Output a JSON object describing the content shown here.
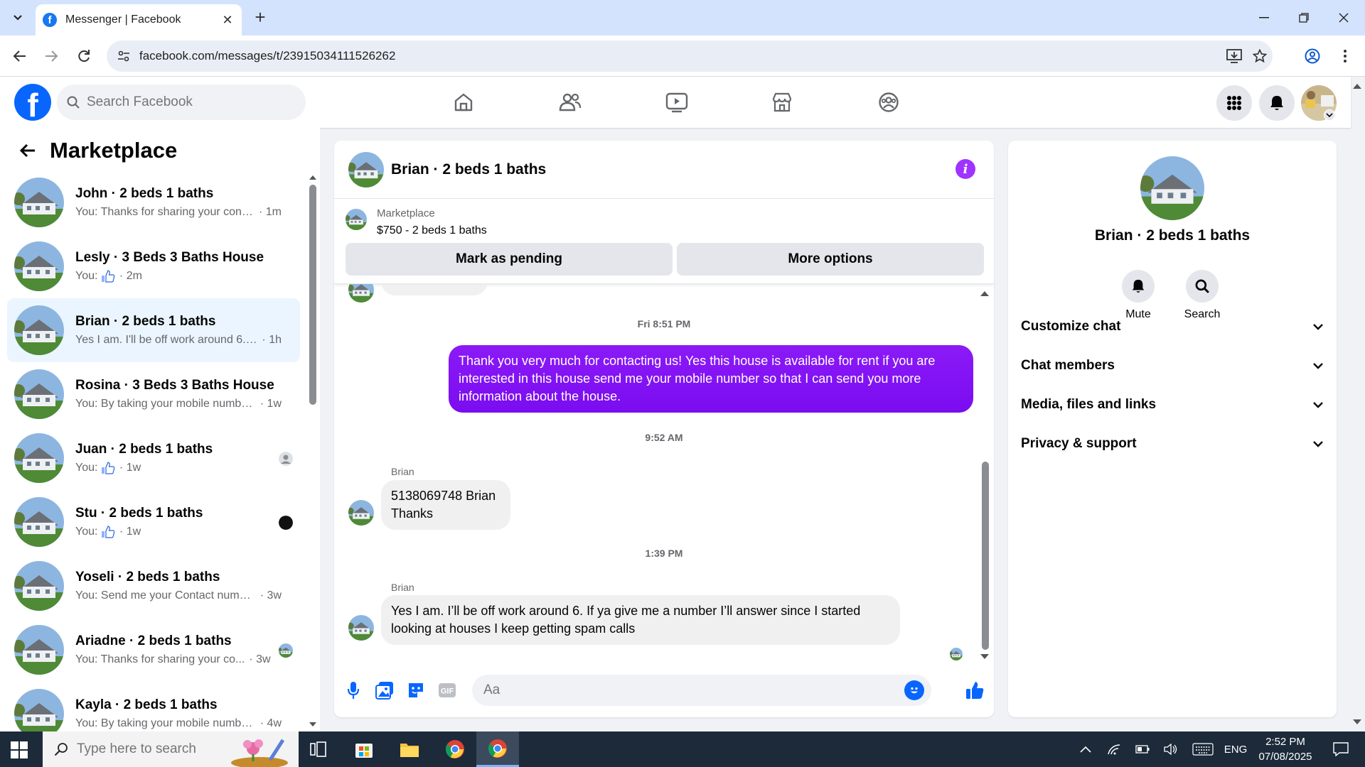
{
  "browser": {
    "tab_title": "Messenger | Facebook",
    "url": "facebook.com/messages/t/23915034111526262"
  },
  "facebook": {
    "logo_letter": "f",
    "search_placeholder": "Search Facebook"
  },
  "left_panel": {
    "title": "Marketplace",
    "chats": [
      {
        "name": "John · 2 beds 1 baths",
        "preview": "You: Thanks for sharing your conta...",
        "time": "1m",
        "thumb": false,
        "active": false
      },
      {
        "name": "Lesly · 3 Beds 3 Baths House",
        "preview": "You:",
        "time": "2m",
        "thumb": true,
        "active": false
      },
      {
        "name": "Brian · 2 beds 1 baths",
        "preview": "Yes I am. I'll be off work around 6. If...",
        "time": "1h",
        "thumb": false,
        "active": true
      },
      {
        "name": "Rosina · 3 Beds 3 Baths House",
        "preview": "You: By taking your mobile number...",
        "time": "1w",
        "thumb": false,
        "active": false
      },
      {
        "name": "Juan · 2 beds 1 baths",
        "preview": "You:",
        "time": "1w",
        "thumb": true,
        "active": false
      },
      {
        "name": "Stu · 2 beds 1 baths",
        "preview": "You:",
        "time": "1w",
        "thumb": true,
        "active": false
      },
      {
        "name": "Yoseli · 2 beds 1 baths",
        "preview": "You: Send me your Contact numbe...",
        "time": "3w",
        "thumb": false,
        "active": false
      },
      {
        "name": "Ariadne · 2 beds 1 baths",
        "preview": "You: Thanks for sharing your co...",
        "time": "3w",
        "thumb": false,
        "active": false
      },
      {
        "name": "Kayla · 2 beds 1 baths",
        "preview": "You: By taking your mobile number...",
        "time": "4w",
        "thumb": false,
        "active": false
      }
    ]
  },
  "conversation": {
    "title": "Brian · 2 beds 1 baths",
    "marketplace_label": "Marketplace",
    "listing": "$750 - 2 beds 1 baths",
    "mark_pending_label": "Mark as pending",
    "more_options_label": "More options",
    "messages": [
      {
        "stamp": "Fri 8:51 PM"
      },
      {
        "direction": "out",
        "text": "Thank you very much for contacting us! Yes this house is available for rent if you are interested in this house send me your mobile number so that I can send you more information about the house."
      },
      {
        "stamp": "9:52 AM"
      },
      {
        "direction": "in",
        "sender": "Brian",
        "text": "5138069748 Brian Thanks"
      },
      {
        "stamp": "1:39 PM"
      },
      {
        "direction": "in",
        "sender": "Brian",
        "text": "Yes I am. I’ll be off work around 6. If ya give me a number I’ll answer since I started looking at houses I keep getting spam calls"
      }
    ],
    "composer_placeholder": "Aa"
  },
  "info_panel": {
    "name": "Brian · 2 beds 1 baths",
    "actions": [
      {
        "label": "Mute",
        "icon": "bell-icon"
      },
      {
        "label": "Search",
        "icon": "search-icon"
      }
    ],
    "sections": [
      "Customize chat",
      "Chat members",
      "Media, files and links",
      "Privacy & support"
    ]
  },
  "taskbar": {
    "search_placeholder": "Type here to search",
    "language": "ENG",
    "time": "2:52 PM",
    "date": "07/08/2025"
  },
  "colors": {
    "facebook_blue": "#0866ff",
    "outgoing_bubble": "#8b1af7",
    "active_chat_bg": "#ebf5ff"
  }
}
